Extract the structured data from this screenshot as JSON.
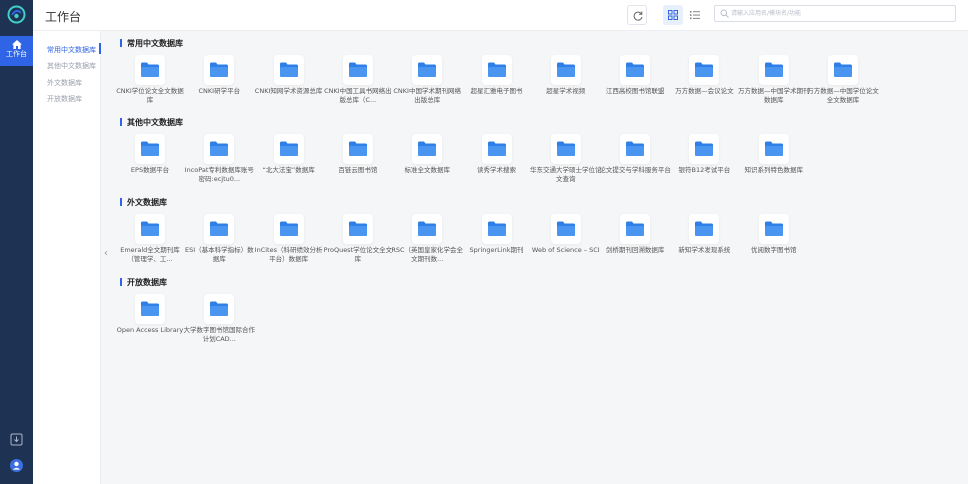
{
  "app": {
    "page_title": "工作台",
    "home_label": "工作台"
  },
  "search": {
    "placeholder": "请输入应用名/模块名/功能"
  },
  "colors": {
    "rail": "#1e3253",
    "accent": "#2f64e6",
    "folder": "#2f7fe8"
  },
  "sidebar": {
    "items": [
      {
        "label": "常用中文数据库",
        "active": true
      },
      {
        "label": "其他中文数据库",
        "active": false
      },
      {
        "label": "外文数据库",
        "active": false
      },
      {
        "label": "开放数据库",
        "active": false
      }
    ]
  },
  "sections": [
    {
      "title": "常用中文数据库",
      "items": [
        "CNKI学位论文全文数据库",
        "CNKI研学平台",
        "CNKI知网学术资源总库",
        "CNKI中国工具书网络出版总库（C...",
        "CNKI中国学术期刊网络出版总库",
        "超星汇雅电子图书",
        "超星学术视频",
        "江西高校图书馆联盟",
        "万方数据—会议论文",
        "万方数据—中国学术期刊数据库",
        "万方数据—中国学位论文全文数据库"
      ]
    },
    {
      "title": "其他中文数据库",
      "items": [
        "EPS数据平台",
        "IncoPat专利数据库账号密码:ecjtu0...",
        "“北大法宝”数据库",
        "百链云图书馆",
        "标准全文数据库",
        "读秀学术搜索",
        "华东交通大学硕士学位论文查询",
        "论文提交与学科服务平台",
        "银符B12考试平台",
        "知识系列特色数据库"
      ]
    },
    {
      "title": "外文数据库",
      "items": [
        "Emerald全文期刊库（管理学、工...",
        "ESI（基本科学指标）数据库",
        "InCites（科研绩效分析平台）数据库",
        "ProQuest学位论文全文库",
        "RSC（英国皇家化学会全文期刊数...",
        "SpringerLink期刊",
        "Web of Science – SCI",
        "剑桥期刊回溯数据库",
        "新知学术发现系统",
        "优阅数字图书馆"
      ]
    },
    {
      "title": "开放数据库",
      "items": [
        "Open Access Library",
        "大学数字图书馆国际合作计划CAD..."
      ]
    }
  ]
}
